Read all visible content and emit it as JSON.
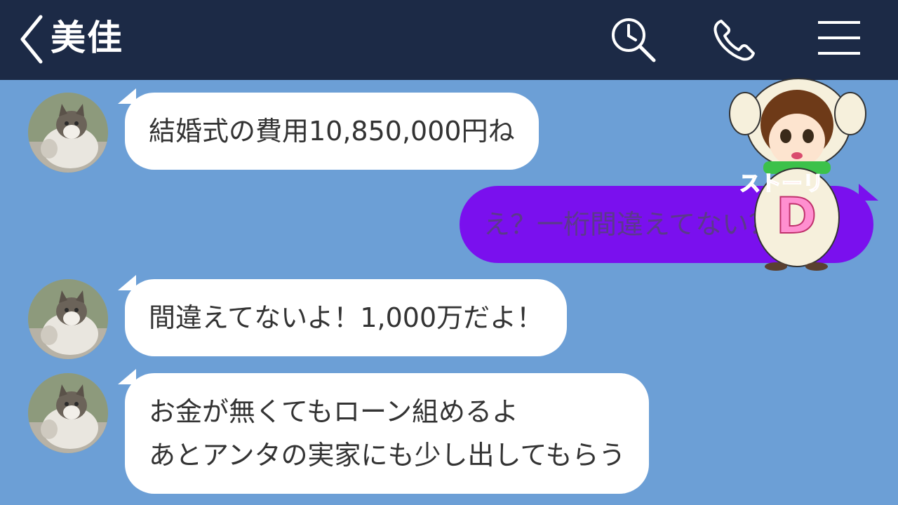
{
  "header": {
    "title": "美佳",
    "back_icon": "chevron-left-icon",
    "search_icon": "search-icon",
    "call_icon": "phone-icon",
    "menu_icon": "menu-icon"
  },
  "messages": [
    {
      "side": "received",
      "lines": [
        "結婚式の費用10,850,000円ね"
      ]
    },
    {
      "side": "sent",
      "lines": [
        "え？一桁間違えてない？"
      ]
    },
    {
      "side": "received",
      "lines": [
        "間違えてないよ！1,000万だよ！"
      ]
    },
    {
      "side": "received",
      "lines": [
        "お金が無くてもローン組めるよ",
        "あとアンタの実家にも少し出してもらう"
      ]
    }
  ],
  "mascot": {
    "badge_text": "ストーリ",
    "letter": "D"
  },
  "colors": {
    "header_bg": "#1c2a46",
    "chat_bg": "#6c9fd6",
    "sent_bubble": "#7a10ee",
    "received_bubble": "#ffffff"
  }
}
